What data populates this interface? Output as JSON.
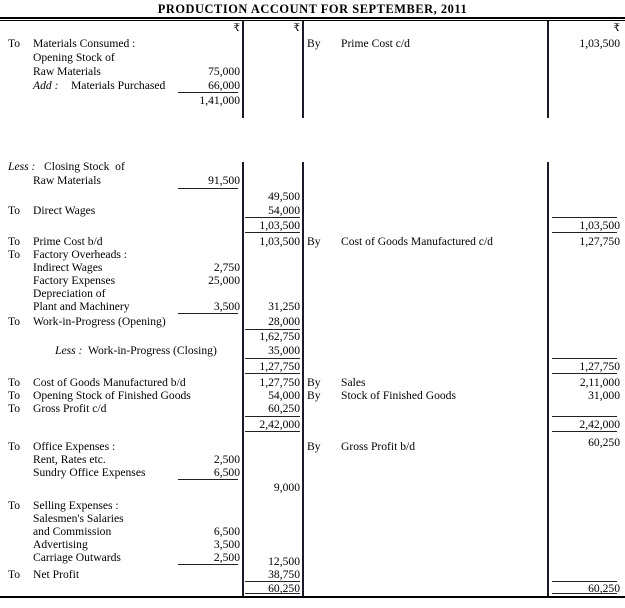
{
  "document": {
    "title": "PRODUCTION ACCOUNT FOR SEPTEMBER, 2011",
    "currency_symbol": "₹"
  },
  "columns": {
    "inner_amount_header": "₹",
    "outer_amount_header": "₹",
    "credit_amount_header": "₹",
    "debit_prefix": "To",
    "credit_prefix": "By"
  },
  "debit": {
    "lines": [
      {
        "prefix": "To",
        "label": "Materials Consumed :"
      },
      {
        "prefix": "",
        "label": "Opening Stock of"
      },
      {
        "prefix": "",
        "label": "Raw Materials",
        "inner": "75,000"
      },
      {
        "prefix": "",
        "label_italic": "Add :",
        "label": "Materials Purchased",
        "inner": "66,000"
      },
      {
        "prefix": "",
        "label": "",
        "inner": "1,41,000"
      },
      {
        "prefix": "",
        "label_italic": "Less :",
        "label": "Closing Stock  of"
      },
      {
        "prefix": "",
        "label": "Raw Materials",
        "inner": "91,500"
      },
      {
        "prefix": "",
        "label": "",
        "outer": "49,500"
      },
      {
        "prefix": "To",
        "label": "Direct Wages",
        "outer": "54,000"
      },
      {
        "prefix": "",
        "label": "",
        "outer": "1,03,500"
      },
      {
        "prefix": "To",
        "label": "Prime Cost b/d",
        "outer": "1,03,500"
      },
      {
        "prefix": "To",
        "label": "Factory Overheads :"
      },
      {
        "prefix": "",
        "label": "Indirect Wages",
        "inner": "2,750"
      },
      {
        "prefix": "",
        "label": "Factory Expenses",
        "inner": "25,000"
      },
      {
        "prefix": "",
        "label": "Depreciation of"
      },
      {
        "prefix": "",
        "label": "Plant and Machinery",
        "inner": "3,500",
        "outer": "31,250"
      },
      {
        "prefix": "To",
        "label": "Work-in-Progress (Opening)",
        "outer": "28,000"
      },
      {
        "prefix": "",
        "label": "",
        "outer": "1,62,750"
      },
      {
        "prefix": "",
        "label_italic": "Less :",
        "label": "Work-in-Progress (Closing)",
        "outer": "35,000"
      },
      {
        "prefix": "",
        "label": "",
        "outer": "1,27,750"
      },
      {
        "prefix": "To",
        "label": "Cost of Goods Manufactured b/d",
        "outer": "1,27,750"
      },
      {
        "prefix": "To",
        "label": "Opening Stock of Finished Goods",
        "outer": "54,000"
      },
      {
        "prefix": "To",
        "label": "Gross Profit c/d",
        "outer": "60,250"
      },
      {
        "prefix": "",
        "label": "",
        "outer": "2,42,000"
      },
      {
        "prefix": "To",
        "label": "Office Expenses :"
      },
      {
        "prefix": "",
        "label": "Rent, Rates etc.",
        "inner": "2,500"
      },
      {
        "prefix": "",
        "label": "Sundry Office Expenses",
        "inner": "6,500"
      },
      {
        "prefix": "",
        "label": "",
        "outer": "9,000"
      },
      {
        "prefix": "To",
        "label": "Selling Expenses :"
      },
      {
        "prefix": "",
        "label": "Salesmen's Salaries"
      },
      {
        "prefix": "",
        "label": "and Commission",
        "inner": "6,500"
      },
      {
        "prefix": "",
        "label": "Advertising",
        "inner": "3,500"
      },
      {
        "prefix": "",
        "label": "Carriage Outwards",
        "inner": "2,500"
      },
      {
        "prefix": "",
        "label": "",
        "outer": "12,500"
      },
      {
        "prefix": "To",
        "label": "Net Profit",
        "outer": "38,750"
      },
      {
        "prefix": "",
        "label": "",
        "outer": "60,250"
      }
    ]
  },
  "credit": {
    "lines": [
      {
        "prefix": "By",
        "label": "Prime Cost c/d",
        "amount": "1,03,500"
      },
      {
        "prefix": "",
        "label": "",
        "amount": "1,03,500"
      },
      {
        "prefix": "By",
        "label": "Cost of Goods Manufactured c/d",
        "amount": "1,27,750"
      },
      {
        "prefix": "",
        "label": "",
        "amount": "1,27,750"
      },
      {
        "prefix": "By",
        "label": "Sales",
        "amount": "2,11,000"
      },
      {
        "prefix": "By",
        "label": "Stock of Finished Goods",
        "amount": "31,000"
      },
      {
        "prefix": "",
        "label": "",
        "amount": "2,42,000"
      },
      {
        "prefix": "By",
        "label": "Gross Profit b/d",
        "amount": "60,250"
      },
      {
        "prefix": "",
        "label": "",
        "amount": "60,250"
      }
    ]
  }
}
